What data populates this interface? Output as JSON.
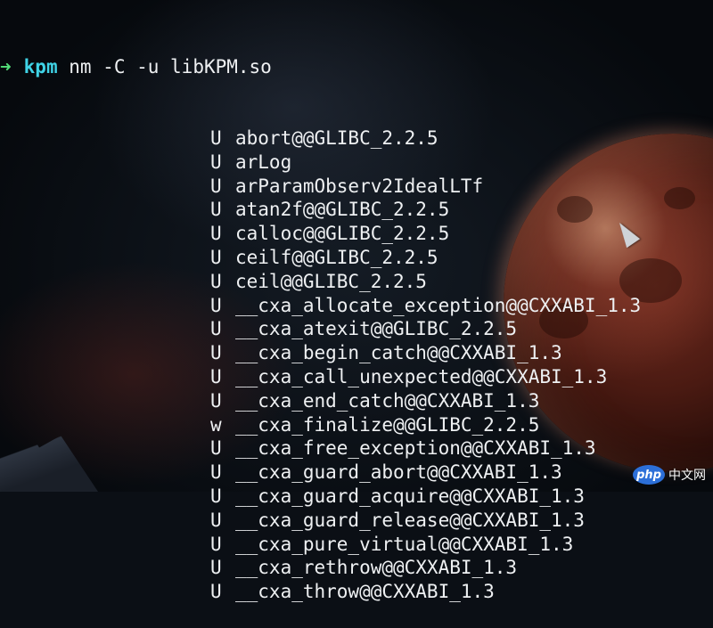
{
  "prompt": {
    "arrow": "➜",
    "directory": "kpm",
    "command": "nm -C -u libKPM.so"
  },
  "symbols": [
    {
      "type": "U",
      "name": "abort@@GLIBC_2.2.5"
    },
    {
      "type": "U",
      "name": "arLog"
    },
    {
      "type": "U",
      "name": "arParamObserv2IdealLTf"
    },
    {
      "type": "U",
      "name": "atan2f@@GLIBC_2.2.5"
    },
    {
      "type": "U",
      "name": "calloc@@GLIBC_2.2.5"
    },
    {
      "type": "U",
      "name": "ceilf@@GLIBC_2.2.5"
    },
    {
      "type": "U",
      "name": "ceil@@GLIBC_2.2.5"
    },
    {
      "type": "U",
      "name": "__cxa_allocate_exception@@CXXABI_1.3"
    },
    {
      "type": "U",
      "name": "__cxa_atexit@@GLIBC_2.2.5"
    },
    {
      "type": "U",
      "name": "__cxa_begin_catch@@CXXABI_1.3"
    },
    {
      "type": "U",
      "name": "__cxa_call_unexpected@@CXXABI_1.3"
    },
    {
      "type": "U",
      "name": "__cxa_end_catch@@CXXABI_1.3"
    },
    {
      "type": "w",
      "name": "__cxa_finalize@@GLIBC_2.2.5"
    },
    {
      "type": "U",
      "name": "__cxa_free_exception@@CXXABI_1.3"
    },
    {
      "type": "U",
      "name": "__cxa_guard_abort@@CXXABI_1.3"
    },
    {
      "type": "U",
      "name": "__cxa_guard_acquire@@CXXABI_1.3"
    },
    {
      "type": "U",
      "name": "__cxa_guard_release@@CXXABI_1.3"
    },
    {
      "type": "U",
      "name": "__cxa_pure_virtual@@CXXABI_1.3"
    },
    {
      "type": "U",
      "name": "__cxa_rethrow@@CXXABI_1.3"
    },
    {
      "type": "U",
      "name": "__cxa_throw@@CXXABI_1.3"
    }
  ],
  "watermark": {
    "badge": "php",
    "text": "中文网"
  },
  "colors": {
    "arrow": "#54e07a",
    "directory": "#3fd3e6",
    "text": "#eef0f2",
    "watermark_badge": "#2c6fd8"
  }
}
